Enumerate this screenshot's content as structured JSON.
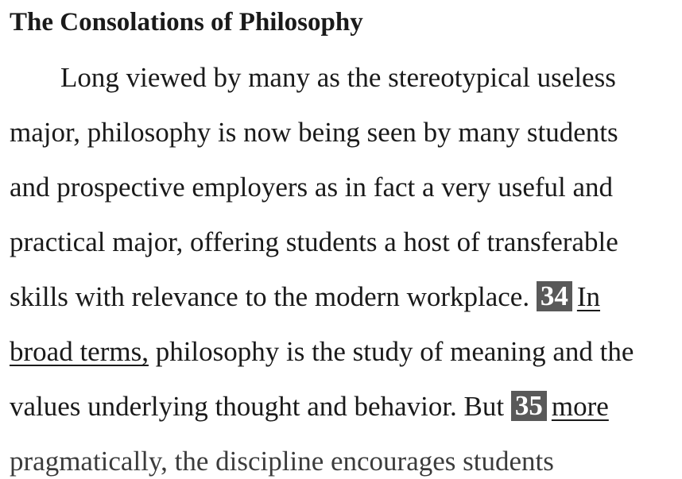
{
  "title": "The Consolations of Philosophy",
  "lines": {
    "l1": "Long viewed by many as the stereotypical useless",
    "l2": "major, philosophy is now being seen by many students",
    "l3": "and prospective employers as in fact a very useful and",
    "l4": "practical major, offering students a host of transferable",
    "l5_text": "skills with relevance to the modern workplace.",
    "l5_badge": "34",
    "l5_underlined": "In",
    "l6_underlined": "broad terms,",
    "l6_text": " philosophy is the study of meaning and the",
    "l7_text": "values underlying thought and behavior. But",
    "l7_badge": "35",
    "l7_underlined": "more",
    "l8_text": "pragmatically, the discipline encourages students"
  }
}
